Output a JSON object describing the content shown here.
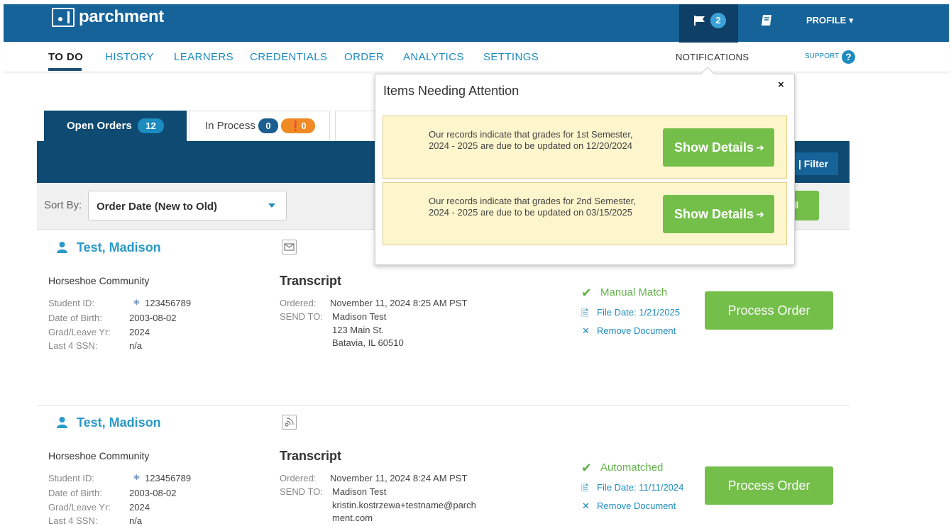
{
  "header": {
    "logo_text": "parchment",
    "notifications_count": "2",
    "profile_label": "PROFILE"
  },
  "nav": {
    "items": [
      "TO DO",
      "HISTORY",
      "LEARNERS",
      "CREDENTIALS",
      "ORDER",
      "ANALYTICS",
      "SETTINGS"
    ],
    "notifications_label": "NOTIFICATIONS",
    "support_label": "SUPPORT",
    "support_icon": "?"
  },
  "tabs": {
    "open_label": "Open Orders",
    "open_count": "12",
    "in_process_label": "In Process",
    "in_process_count": "0",
    "in_process_alert_count": "0"
  },
  "toolbar": {
    "filter_label": "| Filter",
    "sort_label": "Sort By:",
    "sort_value": "Order Date (New to Old)",
    "all_button_label": "ll"
  },
  "popup": {
    "title": "Items Needing Attention",
    "close": "×",
    "alerts": [
      {
        "text": "Our records indicate that grades for 1st Semester, 2024 - 2025 are due to be updated on 12/20/2024",
        "button": "Show Details"
      },
      {
        "text": "Our records indicate that grades for 2nd Semester, 2024 - 2025 are due to be updated on 03/15/2025",
        "button": "Show Details"
      }
    ]
  },
  "orders": [
    {
      "name": "Test, Madison",
      "school": "Horseshoe Community",
      "labels": [
        "Student ID:",
        "Date of Birth:",
        "Grad/Leave Yr:",
        "Last 4 SSN:"
      ],
      "values": [
        "123456789",
        "2003-08-02",
        "2024",
        "n/a"
      ],
      "doc_title": "Transcript",
      "ordered_label": "Ordered:",
      "ordered": "November 11, 2024 8:25 AM PST",
      "sendto_label": "SEND TO:",
      "sendto_lines": [
        "Madison Test",
        "123 Main St.",
        "Batavia, IL 60510"
      ],
      "status": "Manual Match",
      "file_date": "File Date: 1/21/2025",
      "remove": "Remove Document",
      "process": "Process Order"
    },
    {
      "name": "Test, Madison",
      "school": "Horseshoe Community",
      "labels": [
        "Student ID:",
        "Date of Birth:",
        "Grad/Leave Yr:",
        "Last 4 SSN:"
      ],
      "values": [
        "123456789",
        "2003-08-02",
        "2024",
        "n/a"
      ],
      "doc_title": "Transcript",
      "ordered_label": "Ordered:",
      "ordered": "November 11, 2024 8:24 AM PST",
      "sendto_label": "SEND TO:",
      "sendto_lines": [
        "Madison Test",
        "kristin.kostrzewa+testname@parch",
        "ment.com"
      ],
      "status": "Automatched",
      "file_date": "File Date: 11/11/2024",
      "remove": "Remove Document",
      "process": "Process Order"
    }
  ]
}
